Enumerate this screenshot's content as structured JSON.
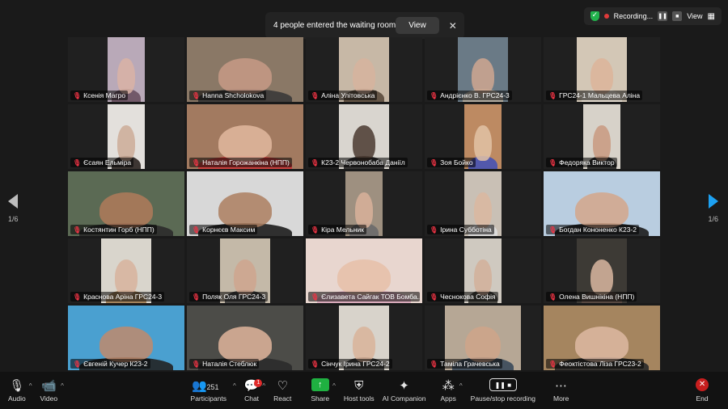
{
  "waiting": {
    "message": "4 people entered the waiting room",
    "view_label": "View",
    "close": "✕"
  },
  "topbar": {
    "recording_label": "Recording...",
    "view_label": "View"
  },
  "nav": {
    "left_page": "1/6",
    "right_page": "1/6"
  },
  "participants": [
    {
      "name": "Ксенія Магро",
      "style": "narrow",
      "bg": "#b9a9b8",
      "skin": "#d9b3a4",
      "cloth": "#6a5060"
    },
    {
      "name": "Hanna Shcholokova",
      "style": "full",
      "bg": "#8a7866",
      "skin": "#c79a86",
      "cloth": "#3a3838"
    },
    {
      "name": "Аліна Улітовська",
      "style": "med",
      "bg": "#c7b8a6",
      "skin": "#d6b39e",
      "cloth": "#5a4a3c"
    },
    {
      "name": "Андрієнко В. ГРС24-3",
      "style": "med",
      "bg": "#6a7a86",
      "skin": "#cfa790",
      "cloth": "#b9b1a3"
    },
    {
      "name": "ГРС24-1 Мальцева Аліна",
      "style": "med",
      "bg": "#d3c7b6",
      "skin": "#dcb49a",
      "cloth": "#e6ddd1"
    },
    {
      "name": "Єсаян Ельміра",
      "style": "narrow",
      "bg": "#e3e0dc",
      "skin": "#ccab98",
      "cloth": "#2a2420"
    },
    {
      "name": "Наталія Горожанкіна (НПП)",
      "style": "full",
      "bg": "#a27a60",
      "skin": "#e2b89f",
      "cloth": "#cf3c3c"
    },
    {
      "name": "К23-2 Червонобаба Даніїл",
      "style": "med",
      "bg": "#d9d5cf",
      "skin": "#4a3a30",
      "cloth": "#222"
    },
    {
      "name": "Зоя Бойко",
      "style": "narrow",
      "bg": "#bd8a62",
      "skin": "#e2c2a6",
      "cloth": "#4652b5"
    },
    {
      "name": "Федоряка Виктор",
      "style": "narrow",
      "bg": "#d7d2c9",
      "skin": "#c99a80",
      "cloth": "#222"
    },
    {
      "name": "Костянтин Горб (НПП)",
      "style": "full",
      "bg": "#5b6a54",
      "skin": "#b07a5a",
      "cloth": "#2b2b2b",
      "active": true
    },
    {
      "name": "Корнєєв Максим",
      "style": "full",
      "bg": "#d8d8d8",
      "skin": "#ad7f60",
      "cloth": "#1d1d1d"
    },
    {
      "name": "Кіра Мельник",
      "style": "narrow",
      "bg": "#9e9080",
      "skin": "#d8b29a",
      "cloth": "#6a6a6a"
    },
    {
      "name": "Ірина Субботіна",
      "style": "narrow",
      "bg": "#c9c0b5",
      "skin": "#dab7a0",
      "cloth": "#ddd"
    },
    {
      "name": "Богдан Кононенко К23-2",
      "style": "full",
      "bg": "#b9cde0",
      "skin": "#d4a68a",
      "cloth": "#1c1c1c"
    },
    {
      "name": "Краснова Аріна ГРС24-3",
      "style": "med",
      "bg": "#d9d5cc",
      "skin": "#d7b39c",
      "cloth": "#9c7a50"
    },
    {
      "name": "Поляк Оля ГРС24-3",
      "style": "med",
      "bg": "#c4b9a8",
      "skin": "#cfa58e",
      "cloth": "#3a3a3a"
    },
    {
      "name": "Єлизавета Сайгак ТОВ Бомба...",
      "style": "full",
      "bg": "#e8d6cf",
      "skin": "#e6bfa8",
      "cloth": "#d7a5b8"
    },
    {
      "name": "Чеснокова Софія",
      "style": "narrow",
      "bg": "#cfc9c0",
      "skin": "#d2b09a",
      "cloth": "#3a3834"
    },
    {
      "name": "Олена Вишнікіна (НПП)",
      "style": "med",
      "bg": "#3d3a35",
      "skin": "#d9b7a0",
      "cloth": "#5a4a42"
    },
    {
      "name": "Євгеній Кучер К23-2",
      "style": "full",
      "bg": "#4aa0d0",
      "skin": "#c08a6c",
      "cloth": "#222"
    },
    {
      "name": "Наталія Стеблюк",
      "style": "full",
      "bg": "#4c4c48",
      "skin": "#e0b59c",
      "cloth": "#2b2b2b"
    },
    {
      "name": "Сінчук Ірина ГРС24-2",
      "style": "med",
      "bg": "#d8d3cb",
      "skin": "#d9b39a",
      "cloth": "#333"
    },
    {
      "name": "Таміла Грачевська",
      "style": "wide",
      "bg": "#b6a795",
      "skin": "#cfa48a",
      "cloth": "#3a4a5a"
    },
    {
      "name": "Феоктістова Ліза ГРС23-2",
      "style": "full",
      "bg": "#a5855f",
      "skin": "#ddb9a2",
      "cloth": "#2a2a2a"
    }
  ],
  "toolbar": {
    "audio": "Audio",
    "video": "Video",
    "participants": "Participants",
    "participants_count": "251",
    "chat": "Chat",
    "chat_badge": "1",
    "react": "React",
    "share": "Share",
    "host_tools": "Host tools",
    "ai_companion": "AI Companion",
    "apps": "Apps",
    "pause_stop_recording": "Pause/stop recording",
    "more": "More",
    "end": "End"
  },
  "colors": {
    "accent_green": "#2ec45a",
    "share_green": "#1fb141",
    "end_red": "#c81e1e",
    "nav_blue": "#1da1f2"
  }
}
